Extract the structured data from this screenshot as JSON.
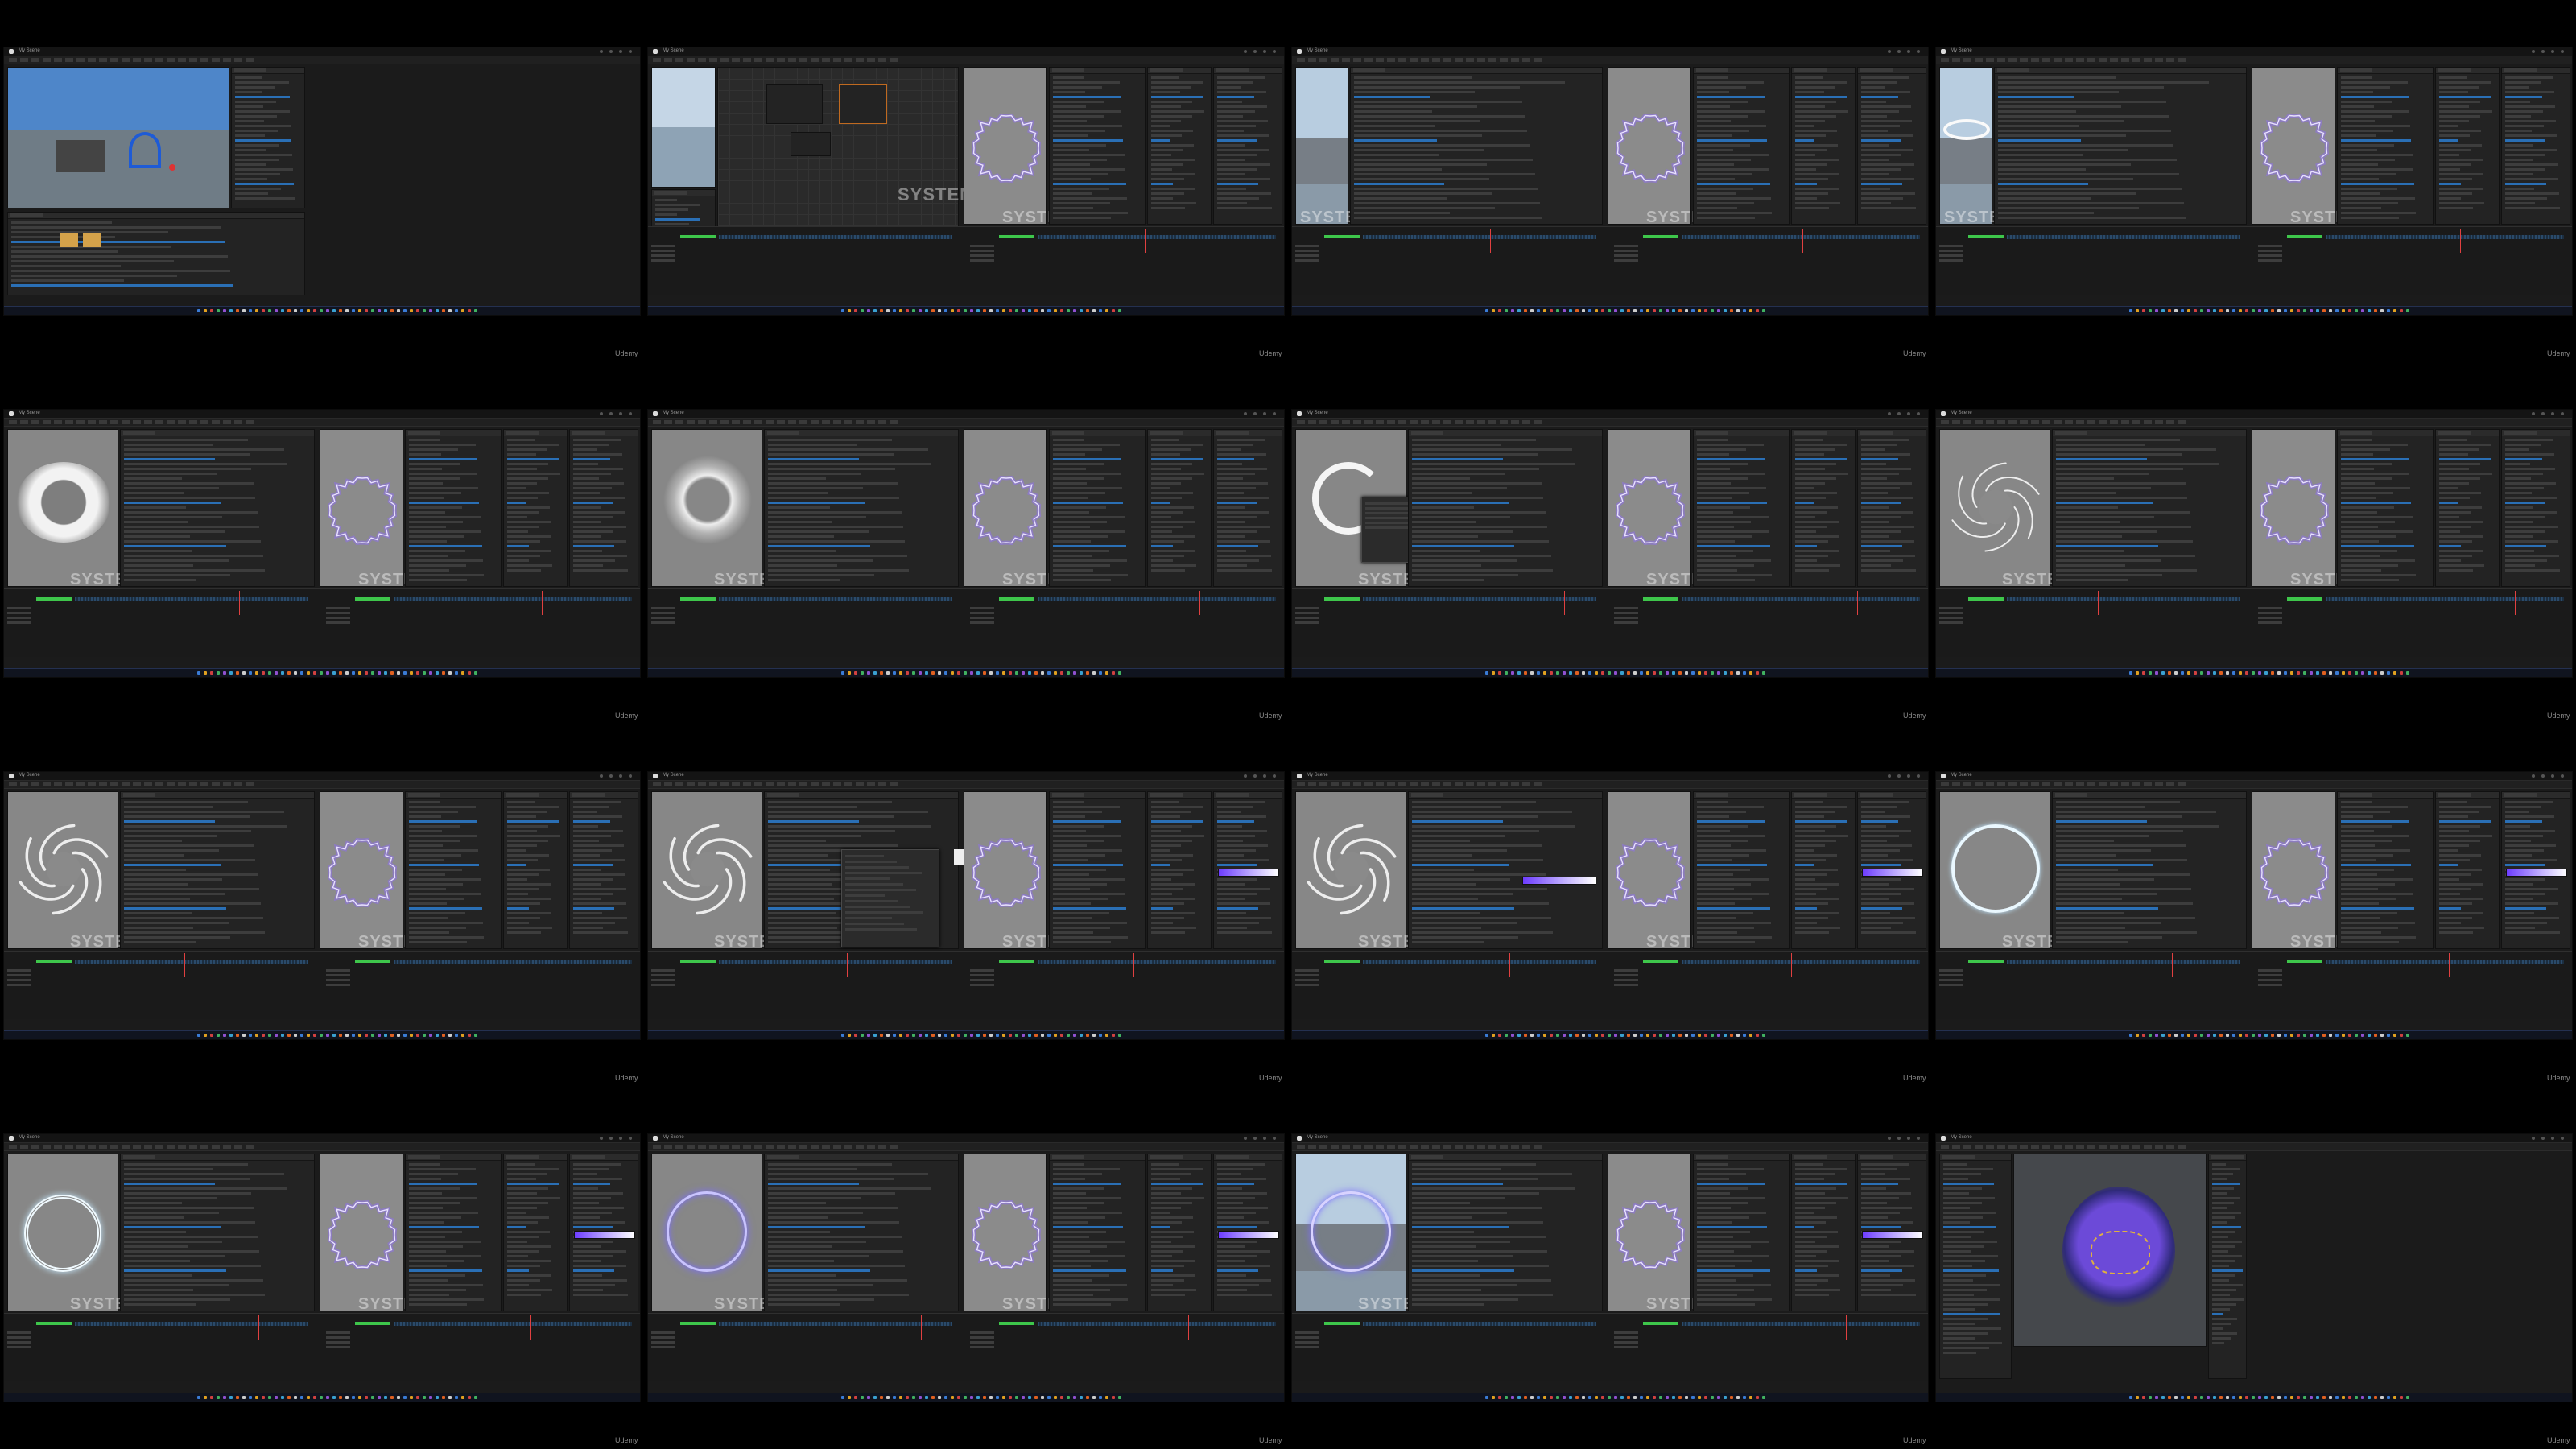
{
  "watermark": "SYSTEM",
  "credit": "Udemy",
  "window_title": "My Scene",
  "accent_colors": {
    "electric_purple": "#8f6bff",
    "timeline_green": "#3ec64b",
    "select_blue": "#1e72c8"
  },
  "frames": [
    {
      "variant": "scene"
    },
    {
      "variant": "graph"
    },
    {
      "variant": "photo"
    },
    {
      "variant": "photo-ring"
    },
    {
      "variant": "white-disc"
    },
    {
      "variant": "particles"
    },
    {
      "variant": "menu"
    },
    {
      "variant": "swirl"
    },
    {
      "variant": "swirl-light"
    },
    {
      "variant": "swirl-popup"
    },
    {
      "variant": "swirl-gradient"
    },
    {
      "variant": "thin-ring"
    },
    {
      "variant": "light-ring"
    },
    {
      "variant": "blue-ring"
    },
    {
      "variant": "blue-ring-photo"
    },
    {
      "variant": "mesh"
    }
  ]
}
